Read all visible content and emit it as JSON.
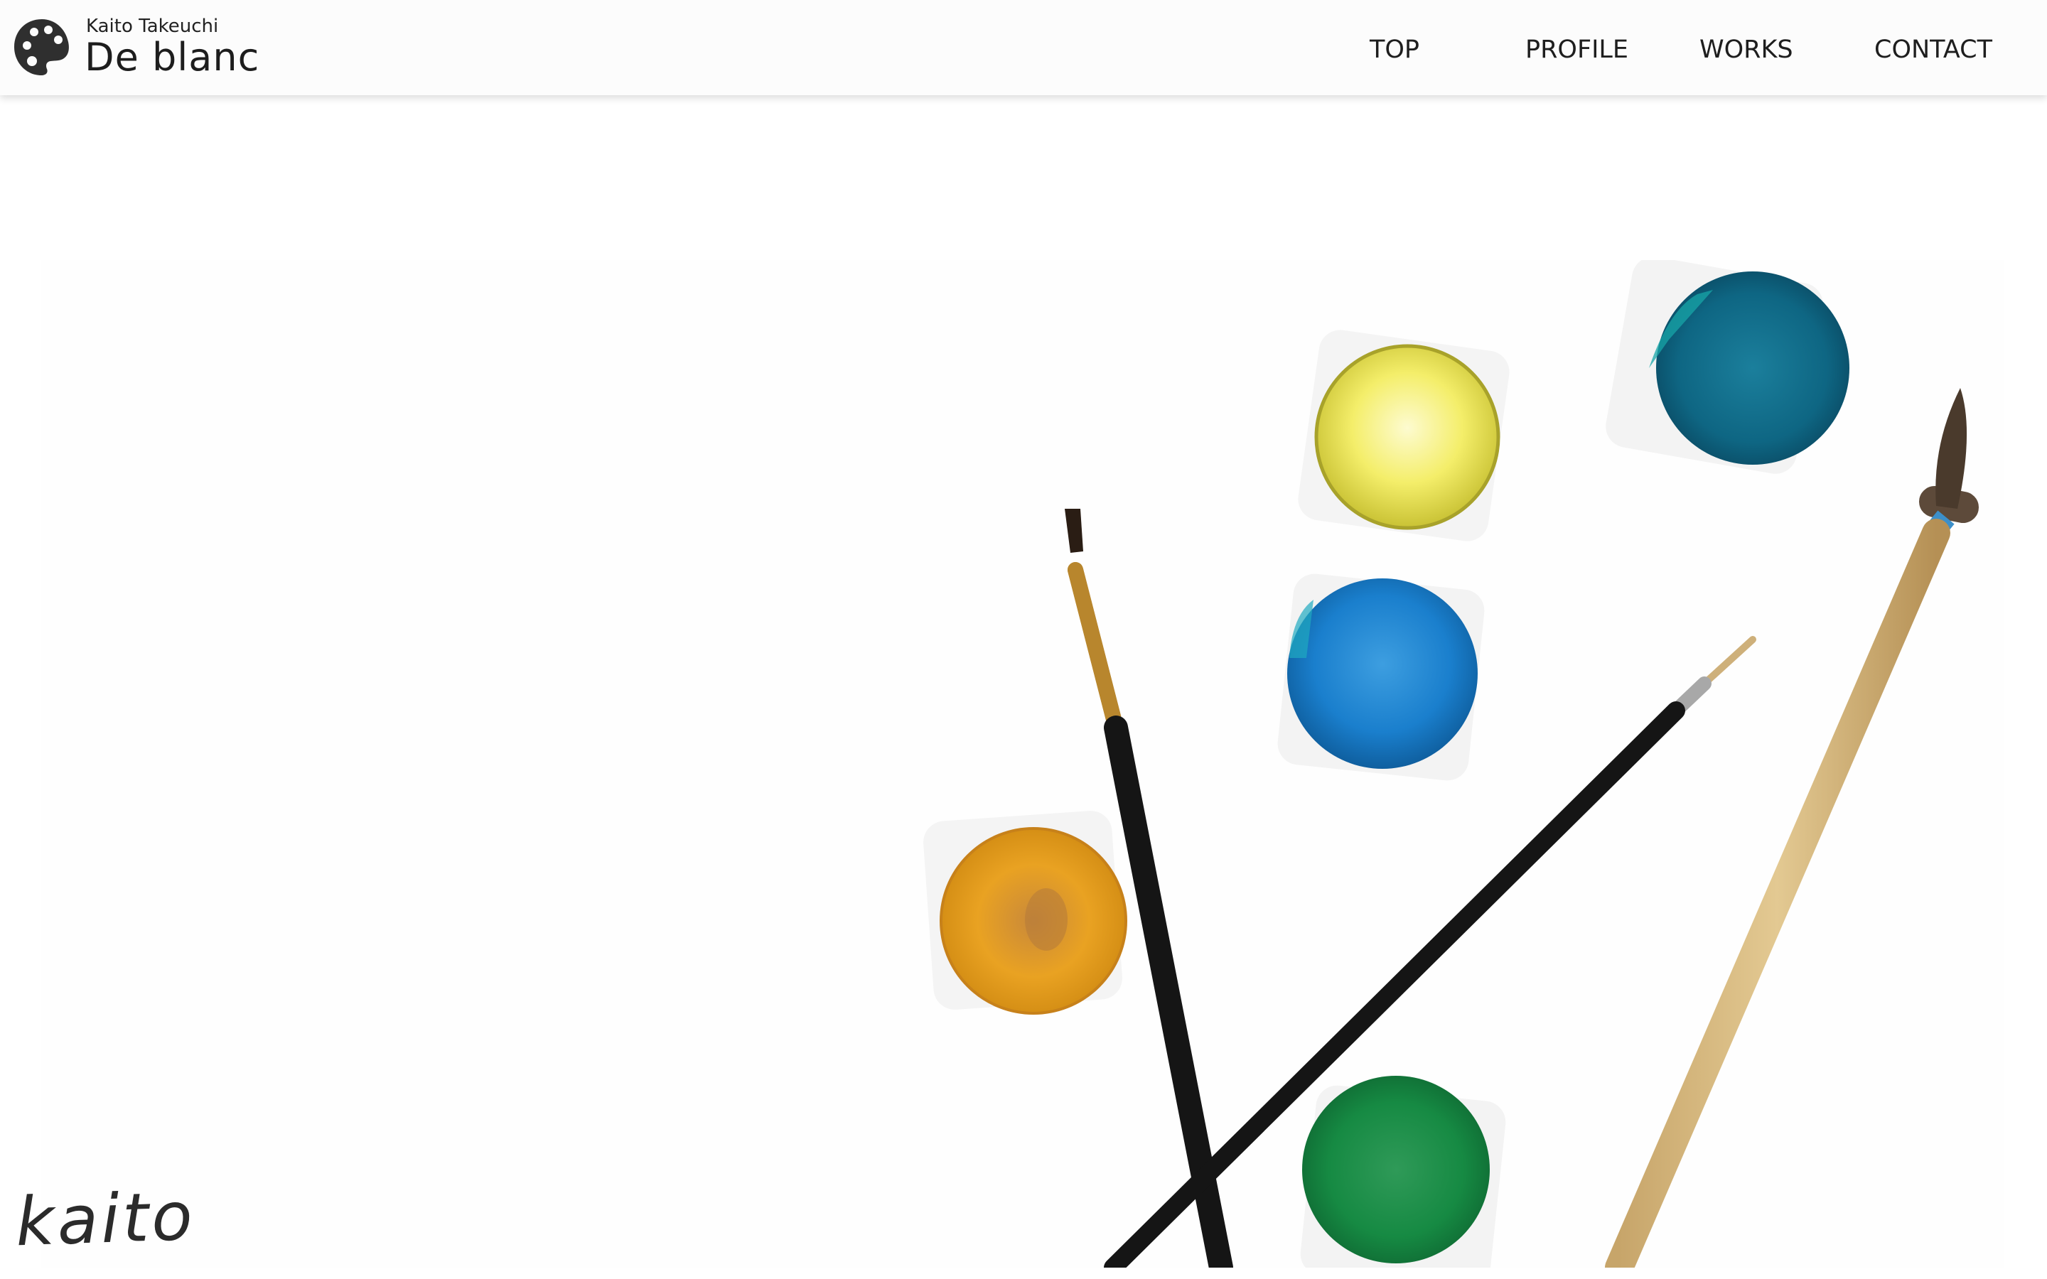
{
  "header": {
    "owner_name": "Kaito Takeuchi",
    "site_title": "De blanc",
    "logo_icon": "palette-icon"
  },
  "nav": {
    "items": [
      {
        "label": "TOP"
      },
      {
        "label": "PROFILE"
      },
      {
        "label": "WORKS"
      },
      {
        "label": "CONTACT"
      }
    ]
  },
  "hero": {
    "image": "watercolor-paints-and-brushes",
    "paint_colors": [
      "#f3ec62",
      "#0f6f8c",
      "#1f86cf",
      "#e8a21e",
      "#1b8a45"
    ]
  },
  "signature": {
    "text": "kaito"
  },
  "colors": {
    "header_bg": "#fcfcfc",
    "text": "#1e1e1e"
  }
}
